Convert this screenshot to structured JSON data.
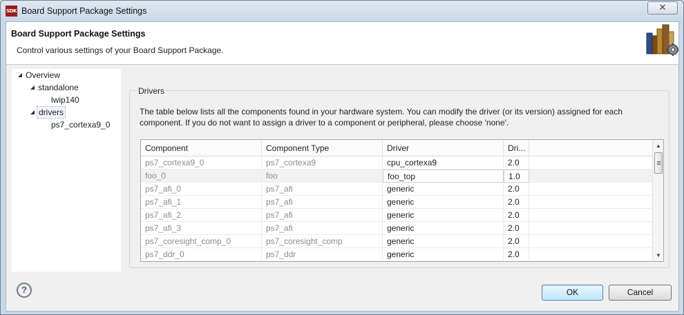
{
  "window": {
    "title": "Board Support Package Settings",
    "app_icon_text": "SDK",
    "close_glyph": "✕"
  },
  "header": {
    "title": "Board Support Package Settings",
    "subtitle": "Control various settings of your Board Support Package.",
    "art_icon": "books-gear-icon"
  },
  "tree": {
    "items": [
      {
        "label": "Overview",
        "arrow": "◢",
        "level": 0
      },
      {
        "label": "standalone",
        "arrow": "◢",
        "level": 1
      },
      {
        "label": "lwip140",
        "arrow": "",
        "level": 2
      },
      {
        "label": "drivers",
        "arrow": "◢",
        "level": 1,
        "selected": true
      },
      {
        "label": "ps7_cortexa9_0",
        "arrow": "",
        "level": 2
      }
    ]
  },
  "drivers": {
    "group_title": "Drivers",
    "description": "The table below lists all the components found in your hardware system. You can modify the driver (or its version) assigned for each component. If you do not want to assign a driver to a component or peripheral, please choose 'none'.",
    "columns": [
      "Component",
      "Component Type",
      "Driver",
      "Dri..."
    ],
    "rows": [
      {
        "component": "ps7_cortexa9_0",
        "type": "ps7_cortexa9",
        "driver": "cpu_cortexa9",
        "version": "2.0"
      },
      {
        "component": "foo_0",
        "type": "foo",
        "driver": "foo_top",
        "version": "1.0"
      },
      {
        "component": "ps7_afi_0",
        "type": "ps7_afi",
        "driver": "generic",
        "version": "2.0"
      },
      {
        "component": "ps7_afi_1",
        "type": "ps7_afi",
        "driver": "generic",
        "version": "2.0"
      },
      {
        "component": "ps7_afi_2",
        "type": "ps7_afi",
        "driver": "generic",
        "version": "2.0"
      },
      {
        "component": "ps7_afi_3",
        "type": "ps7_afi",
        "driver": "generic",
        "version": "2.0"
      },
      {
        "component": "ps7_coresight_comp_0",
        "type": "ps7_coresight_comp",
        "driver": "generic",
        "version": "2.0"
      },
      {
        "component": "ps7_ddr_0",
        "type": "ps7_ddr",
        "driver": "generic",
        "version": "2.0"
      }
    ],
    "scroll_up": "▲",
    "scroll_down": "▼"
  },
  "footer": {
    "help_label": "?",
    "ok_label": "OK",
    "cancel_label": "Cancel"
  },
  "colors": {
    "ok_accent": "#3c7fb1",
    "muted_text": "#8c8c8c",
    "titlebar": "#c9d7e6"
  }
}
